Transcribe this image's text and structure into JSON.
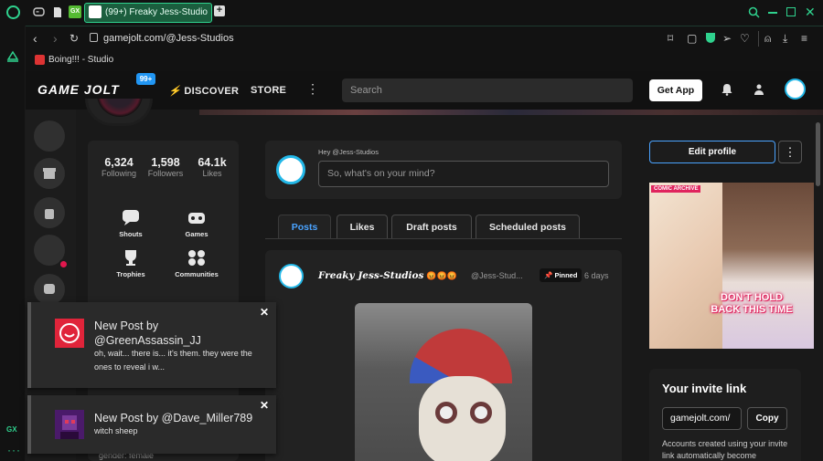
{
  "browser": {
    "tab_title": "(99+) Freaky Jess-Studio",
    "new_tab": "+",
    "url": "gamejolt.com/@Jess-Studios",
    "bookmark": "Boing!!! - Studio",
    "gx_label": "GX",
    "accent": "#2fd28e"
  },
  "site": {
    "logo": "GAME JOLT",
    "badge": "99+",
    "discover": "DISCOVER",
    "store": "STORE",
    "search_placeholder": "Search",
    "get_app": "Get App"
  },
  "profile": {
    "stats": [
      {
        "value": "6,324",
        "label": "Following"
      },
      {
        "value": "1,598",
        "label": "Followers"
      },
      {
        "value": "64.1k",
        "label": "Likes"
      }
    ],
    "quick_links": [
      "Shouts",
      "Games",
      "Trophies",
      "Communities"
    ],
    "gender_text": "gender: female"
  },
  "composer": {
    "greeting": "Hey @Jess-Studios",
    "placeholder": "So, what's on your mind?"
  },
  "tabs": [
    "Posts",
    "Likes",
    "Draft posts",
    "Scheduled posts"
  ],
  "post": {
    "author": "Freaky Jess-Studios",
    "emojis": "😡😡😡",
    "handle": "@Jess-Stud...",
    "pinned": "Pinned",
    "age": "6 days"
  },
  "right": {
    "edit_profile": "Edit profile",
    "ad_tag": "COMIC ARCHIVE",
    "ad_text": "DON'T HOLD BACK THIS TIME",
    "invite_title": "Your invite link",
    "invite_link": "gamejolt.com/",
    "copy": "Copy",
    "invite_desc": "Accounts created using your invite link automatically become"
  },
  "notifications": [
    {
      "title": "New Post by @GreenAssassin_JJ",
      "body": "oh, wait... there is... it's them. they were the ones to reveal i w..."
    },
    {
      "title": "New Post by @Dave_Miller789",
      "body": "witch sheep"
    }
  ]
}
